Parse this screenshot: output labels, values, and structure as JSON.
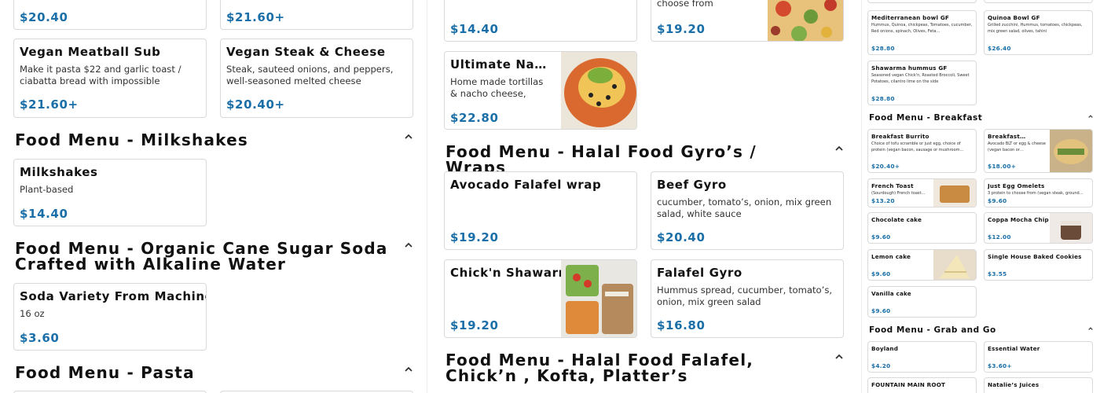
{
  "panel1": {
    "top_prices": [
      "$20.40",
      "$21.60+"
    ],
    "cards": [
      {
        "title": "Vegan Meatball Sub",
        "desc": "Make it pasta $22 and garlic toast / ciabatta bread with impossible meatballs , marinara…",
        "price": "$21.60+"
      },
      {
        "title": "Vegan Steak & Cheese",
        "desc": "Steak, sauteed onions, and peppers, well-seasoned melted cheese",
        "price": "$20.40+"
      }
    ],
    "sections": [
      {
        "title": "Food Menu - Milkshakes"
      },
      {
        "title": "Food Menu - Organic Cane Sugar Soda Crafted with Alkaline Water"
      },
      {
        "title": "Food Menu - Pasta"
      }
    ],
    "milkshake": {
      "title": "Milkshakes",
      "desc": "Plant-based",
      "price": "$14.40"
    },
    "soda": {
      "title": "Soda Variety From Machine",
      "desc": "16 oz",
      "price": "$3.60"
    }
  },
  "panel2": {
    "top": [
      {
        "price": "$14.40"
      },
      {
        "desc": "choose from (beyond,…",
        "price": "$19.20"
      }
    ],
    "nachos": {
      "title": "Ultimate Nacho…",
      "desc": "Home made tortillas & nacho cheese, beans,…",
      "price": "$22.80"
    },
    "sections": [
      {
        "title": "Food Menu - Halal Food Gyro’s / Wraps"
      },
      {
        "title": "Food Menu - Halal Food Falafel, Chick’n , Kofta, Platter’s"
      }
    ],
    "cards": [
      {
        "title": "Avocado Falafel wrap",
        "desc": "",
        "price": "$19.20"
      },
      {
        "title": "Beef Gyro",
        "desc": "cucumber, tomato’s, onion, mix green salad, white sauce",
        "price": "$20.40"
      },
      {
        "title": "Chick'n Shawarma",
        "desc": "",
        "price": "$19.20"
      },
      {
        "title": "Falafel Gyro",
        "desc": "Hummus spread, cucumber, tomato’s, onion, mix green salad",
        "price": "$16.80"
      }
    ]
  },
  "panel3": {
    "top_cards": [
      {
        "title": "Mediterranean bowl GF",
        "desc": "Hummus, Quinoa, chickpeas, Tomatoes, cucumber, Red onions, spinach, Olives, Feta…",
        "price": "$28.80"
      },
      {
        "title": "Quinoa Bowl GF",
        "desc": "Grilled zucchini, Hummus, tomatoes, chickpeas, mix green salad, olives, tahini",
        "price": "$26.40"
      },
      {
        "title": "Shawarma hummus GF",
        "desc": "Seasoned vegan Chick'n, Roasted Broccoli, Sweet Potatoes, cilantro lime on the side",
        "price": "$28.80"
      }
    ],
    "sections": [
      {
        "title": "Food Menu - Breakfast"
      },
      {
        "title": "Food Menu - Grab and Go"
      }
    ],
    "breakfast": [
      {
        "title": "Breakfast Burrito",
        "desc": "Choice of tofu scramble or just egg, choice of protein (vegan bacon, sausage or mushroom…",
        "price": "$20.40+"
      },
      {
        "title": "Breakfast…",
        "desc": "Avocado BLT or egg & cheese (vegan bacon or…",
        "price": "$18.00+"
      },
      {
        "title": "French Toast",
        "desc": "(Sourdough) French toast…",
        "price": "$13.20"
      },
      {
        "title": "Just Egg Omelets",
        "desc": "3 protein to choose from (vegan steak, ground…",
        "price": "$9.60"
      },
      {
        "title": "Chocolate cake",
        "desc": "",
        "price": "$9.60"
      },
      {
        "title": "Coppa Mocha Chip",
        "desc": "",
        "price": "$12.00"
      },
      {
        "title": "Lemon cake",
        "desc": "",
        "price": "$9.60"
      },
      {
        "title": "Single House Baked Cookies",
        "desc": "",
        "price": "$3.55"
      },
      {
        "title": "Vanilla cake",
        "desc": "",
        "price": "$9.60"
      }
    ],
    "grab": [
      {
        "title": "Boyland",
        "price": "$4.20"
      },
      {
        "title": "Essential Water",
        "price": "$3.60+"
      },
      {
        "title": "FOUNTAIN MAIN ROOT",
        "price": ""
      },
      {
        "title": "Natalie’s Juices",
        "price": ""
      }
    ]
  }
}
